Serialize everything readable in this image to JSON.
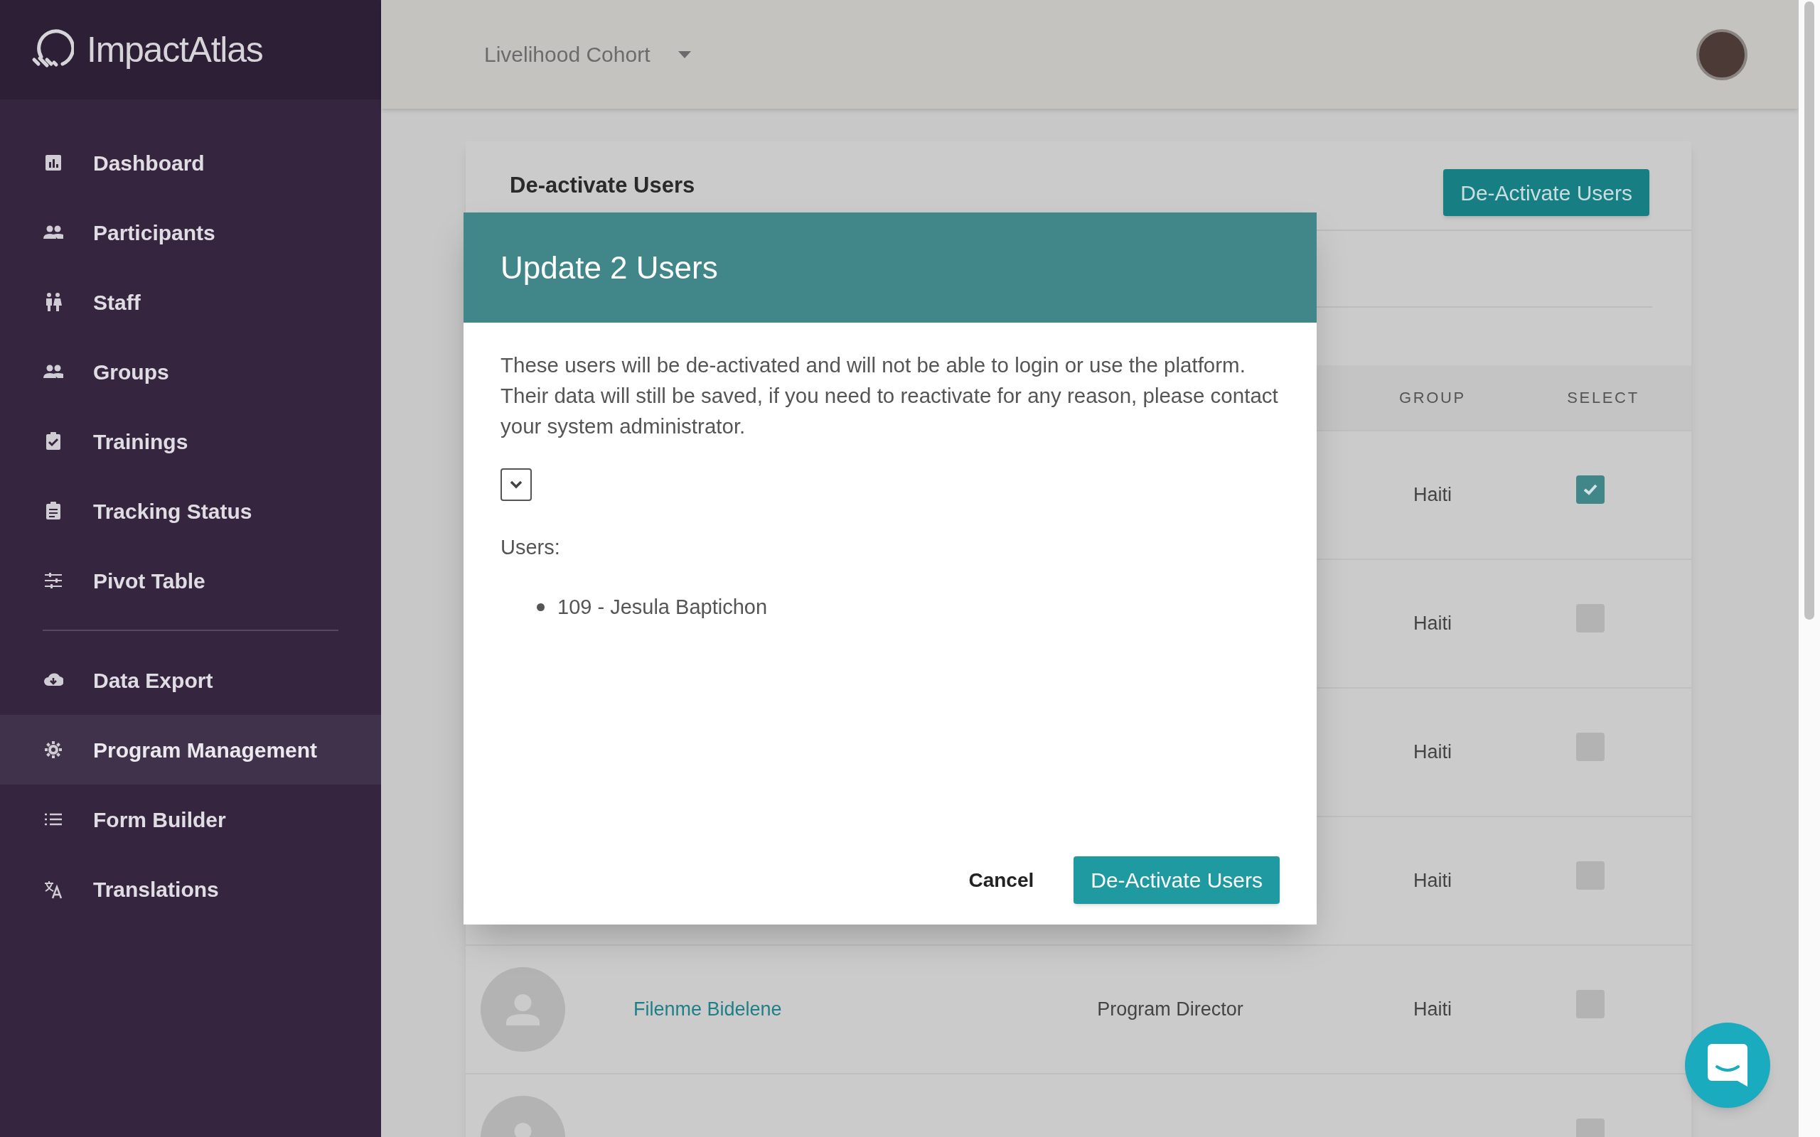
{
  "brand": {
    "name": "ImpactAtlas"
  },
  "sidebar": {
    "sections": [
      {
        "items": [
          {
            "label": "Dashboard",
            "selected": false
          },
          {
            "label": "Participants",
            "selected": false
          },
          {
            "label": "Staff",
            "selected": false
          },
          {
            "label": "Groups",
            "selected": false
          },
          {
            "label": "Trainings",
            "selected": false
          },
          {
            "label": "Tracking Status",
            "selected": false
          },
          {
            "label": "Pivot Table",
            "selected": false
          }
        ]
      },
      {
        "items": [
          {
            "label": "Data Export",
            "selected": false
          },
          {
            "label": "Program Management",
            "selected": true
          },
          {
            "label": "Form Builder",
            "selected": false
          },
          {
            "label": "Translations",
            "selected": false
          }
        ]
      }
    ]
  },
  "topbar": {
    "cohort": "Livelihood Cohort"
  },
  "card": {
    "title": "De-activate Users",
    "action": "De-Activate Users",
    "columns": [
      "GROUP",
      "SELECT"
    ],
    "rows": [
      {
        "group": "Haiti",
        "checked": true,
        "avatar": false
      },
      {
        "group": "Haiti",
        "checked": false,
        "avatar": false
      },
      {
        "group": "Haiti",
        "checked": false,
        "avatar": false
      },
      {
        "group": "Haiti",
        "checked": false,
        "avatar": false
      },
      {
        "name": "Filenme Bidelene",
        "role": "Program Director",
        "group": "Haiti",
        "checked": false,
        "avatar": true
      },
      {
        "checked": false,
        "avatar": true
      }
    ]
  },
  "modal": {
    "title": "Update 2 Users",
    "message": "These users will be de-activated and will not be able to login or use the platform. Their data will still be saved, if you need to reactivate for any reason, please contact your system administrator.",
    "users_label": "Users:",
    "users": [
      "109 - Jesula Baptichon"
    ],
    "buttons": [
      {
        "label": "Cancel",
        "kind": "text"
      },
      {
        "label": "De-Activate Users",
        "kind": "primary"
      }
    ]
  }
}
